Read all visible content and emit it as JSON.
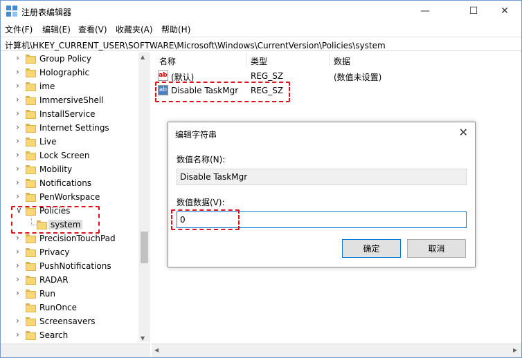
{
  "window": {
    "title": "注册表编辑器",
    "minimize_glyph": "—",
    "maximize_glyph": "☐",
    "close_glyph": "✕"
  },
  "menu": [
    "文件(F)",
    "编辑(E)",
    "查看(V)",
    "收藏夹(A)",
    "帮助(H)"
  ],
  "address": "计算机\\HKEY_CURRENT_USER\\SOFTWARE\\Microsoft\\Windows\\CurrentVersion\\Policies\\system",
  "tree": {
    "items": [
      {
        "label": "Group Policy",
        "expander": ">"
      },
      {
        "label": "Holographic",
        "expander": ">"
      },
      {
        "label": "ime",
        "expander": ">"
      },
      {
        "label": "ImmersiveShell",
        "expander": ">"
      },
      {
        "label": "InstallService",
        "expander": ">"
      },
      {
        "label": "Internet Settings",
        "expander": ">"
      },
      {
        "label": "Live",
        "expander": ">"
      },
      {
        "label": "Lock Screen",
        "expander": ">"
      },
      {
        "label": "Mobility",
        "expander": ">"
      },
      {
        "label": "Notifications",
        "expander": ">"
      },
      {
        "label": "PenWorkspace",
        "expander": ">"
      },
      {
        "label": "Policies",
        "expander": "v"
      },
      {
        "label": "system",
        "expander": ""
      },
      {
        "label": "PrecisionTouchPad",
        "expander": ">"
      },
      {
        "label": "Privacy",
        "expander": ">"
      },
      {
        "label": "PushNotifications",
        "expander": ">"
      },
      {
        "label": "RADAR",
        "expander": ">"
      },
      {
        "label": "Run",
        "expander": ">"
      },
      {
        "label": "RunOnce",
        "expander": ""
      },
      {
        "label": "Screensavers",
        "expander": ">"
      },
      {
        "label": "Search",
        "expander": ">"
      }
    ]
  },
  "list": {
    "headers": {
      "name": "名称",
      "type": "类型",
      "data": "数据"
    },
    "rows": [
      {
        "icon": "ab",
        "name": "(默认)",
        "type": "REG_SZ",
        "data": "(数值未设置)"
      },
      {
        "icon": "ab",
        "name": "Disable TaskMgr",
        "type": "REG_SZ",
        "data": ""
      }
    ]
  },
  "dialog": {
    "title": "编辑字符串",
    "close_glyph": "✕",
    "name_label": "数值名称(N):",
    "name_value": "Disable TaskMgr",
    "data_label": "数值数据(V):",
    "data_value": "0",
    "ok_label": "确定",
    "cancel_label": "取消"
  },
  "colors": {
    "highlight_dash": "#e0101a",
    "focus_border": "#0078d7",
    "folder_yellow": "#f8d775"
  }
}
